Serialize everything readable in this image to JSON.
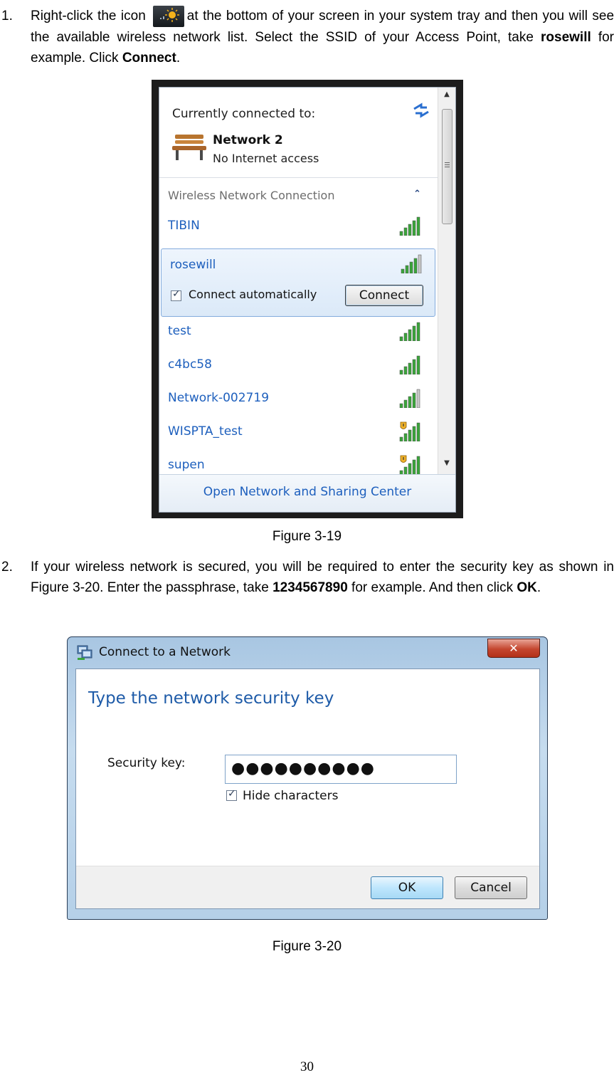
{
  "steps": [
    {
      "number": "1.",
      "text_a": "Right-click the icon",
      "text_b": "at the bottom of your screen in your system tray and then you will see the available wireless network list. Select the SSID of your Access Point, take",
      "bold_1": "rosewill",
      "text_c": "for example. Click",
      "bold_2": "Connect",
      "text_d": "."
    },
    {
      "number": "2.",
      "text_a": "If your wireless network is secured, you will be required to enter the security key as shown in Figure 3-20. Enter the passphrase, take",
      "bold_1": "1234567890",
      "text_b": "for example. And then click",
      "bold_2": "OK",
      "text_c": "."
    }
  ],
  "figure_19": {
    "caption": "Figure 3-19",
    "currently_connected_label": "Currently connected to:",
    "connected_network": "Network  2",
    "connected_status": "No Internet access",
    "section_label": "Wireless Network Connection",
    "networks": [
      {
        "ssid": "TIBIN",
        "bars": 5,
        "secured_warning": false
      },
      {
        "ssid": "rosewill",
        "bars": 4,
        "secured_warning": false,
        "selected": true
      },
      {
        "ssid": "test",
        "bars": 5,
        "secured_warning": false
      },
      {
        "ssid": "c4bc58",
        "bars": 5,
        "secured_warning": false
      },
      {
        "ssid": "Network-002719",
        "bars": 4,
        "secured_warning": false
      },
      {
        "ssid": "WISPTA_test",
        "bars": 5,
        "secured_warning": true
      },
      {
        "ssid": "supen",
        "bars": 5,
        "secured_warning": true
      }
    ],
    "connect_automatically_label": "Connect automatically",
    "connect_automatically_checked": true,
    "connect_button": "Connect",
    "footer_link": "Open Network and Sharing Center"
  },
  "figure_20": {
    "caption": "Figure 3-20",
    "window_title": "Connect to a Network",
    "close_glyph": "✕",
    "heading": "Type the network security key",
    "security_key_label": "Security key:",
    "security_key_value": "●●●●●●●●●●",
    "hide_characters_label": "Hide characters",
    "hide_characters_checked": true,
    "ok_button": "OK",
    "cancel_button": "Cancel"
  },
  "page_number": "30",
  "colors": {
    "link_blue": "#1d5fbd",
    "heading_blue": "#1e5ba8",
    "signal_green": "#3aa53a"
  }
}
